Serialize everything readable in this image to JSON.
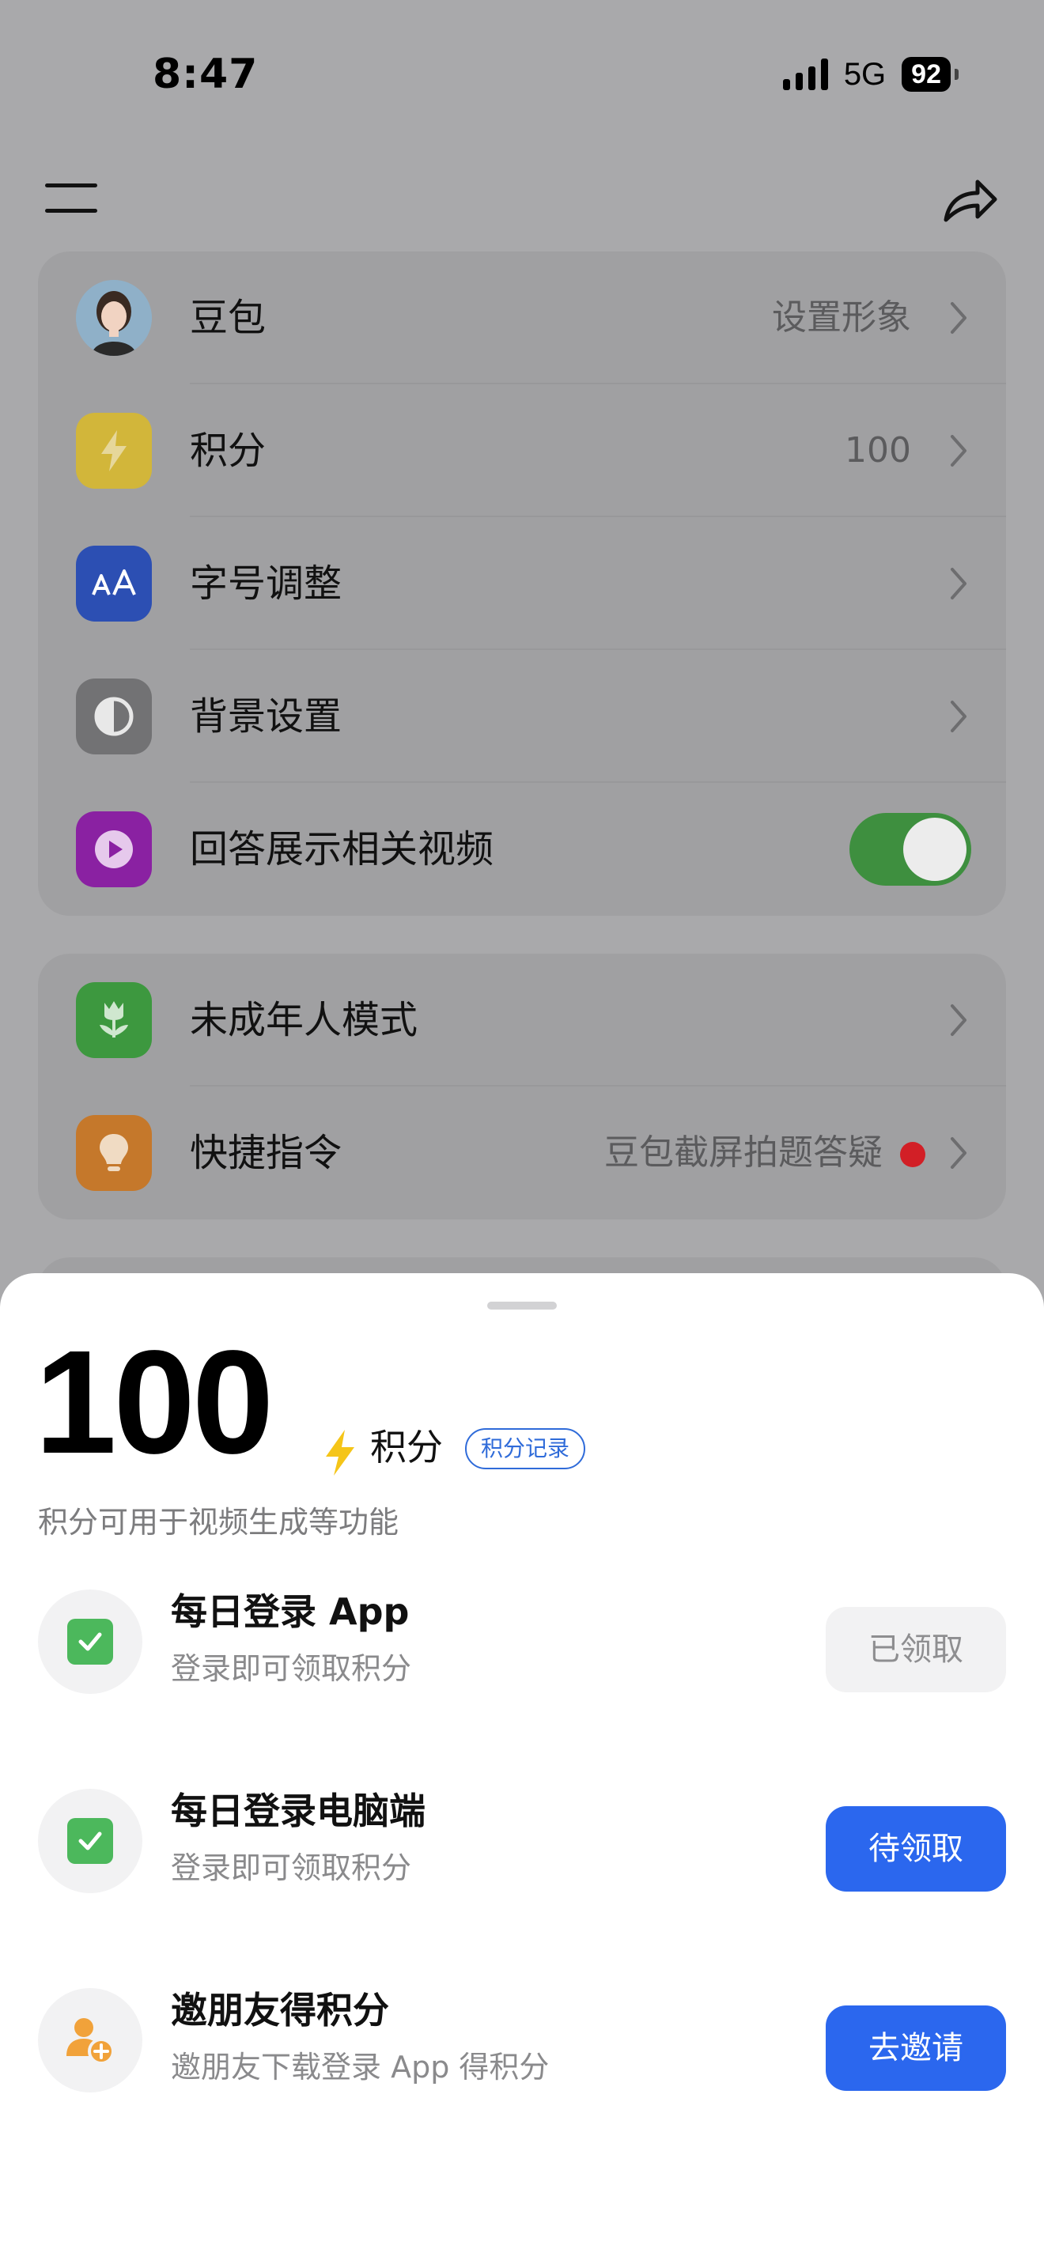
{
  "status_bar": {
    "time": "8:47",
    "network": "5G",
    "battery": "92"
  },
  "settings_group_1": [
    {
      "label": "豆包",
      "value": "设置形象",
      "icon": "avatar"
    },
    {
      "label": "积分",
      "value": "100",
      "icon": "lightning-icon",
      "color": "#d2b63a"
    },
    {
      "label": "字号调整",
      "value": "",
      "icon": "font-size-icon",
      "color": "#2c4fb3"
    },
    {
      "label": "背景设置",
      "value": "",
      "icon": "contrast-icon",
      "color": "#727274"
    },
    {
      "label": "回答展示相关视频",
      "value": "",
      "icon": "play-icon",
      "color": "#8a21a2",
      "toggle": true
    }
  ],
  "settings_group_2": [
    {
      "label": "未成年人模式",
      "value": "",
      "icon": "tulip-icon",
      "color": "#3d983f"
    },
    {
      "label": "快捷指令",
      "value": "豆包截屏拍题答疑",
      "icon": "lightbulb-icon",
      "color": "#c5782b",
      "badge": true
    }
  ],
  "sheet": {
    "points": "100",
    "unit": "积分",
    "record_link": "积分记录",
    "description": "积分可用于视频生成等功能",
    "tasks": [
      {
        "title": "每日登录 App",
        "subtitle": "登录即可领取积分",
        "button": "已领取",
        "state": "done"
      },
      {
        "title": "每日登录电脑端",
        "subtitle": "登录即可领取积分",
        "button": "待领取",
        "state": "pending"
      },
      {
        "title": "邀朋友得积分",
        "subtitle": "邀朋友下载登录 App 得积分",
        "button": "去邀请",
        "state": "invite"
      }
    ]
  },
  "colors": {
    "accent": "#2b67ee",
    "toggle_on": "#3e8f3f",
    "check": "#4cb85c",
    "badge_red": "#d21f26",
    "bolt": "#f5c518"
  }
}
